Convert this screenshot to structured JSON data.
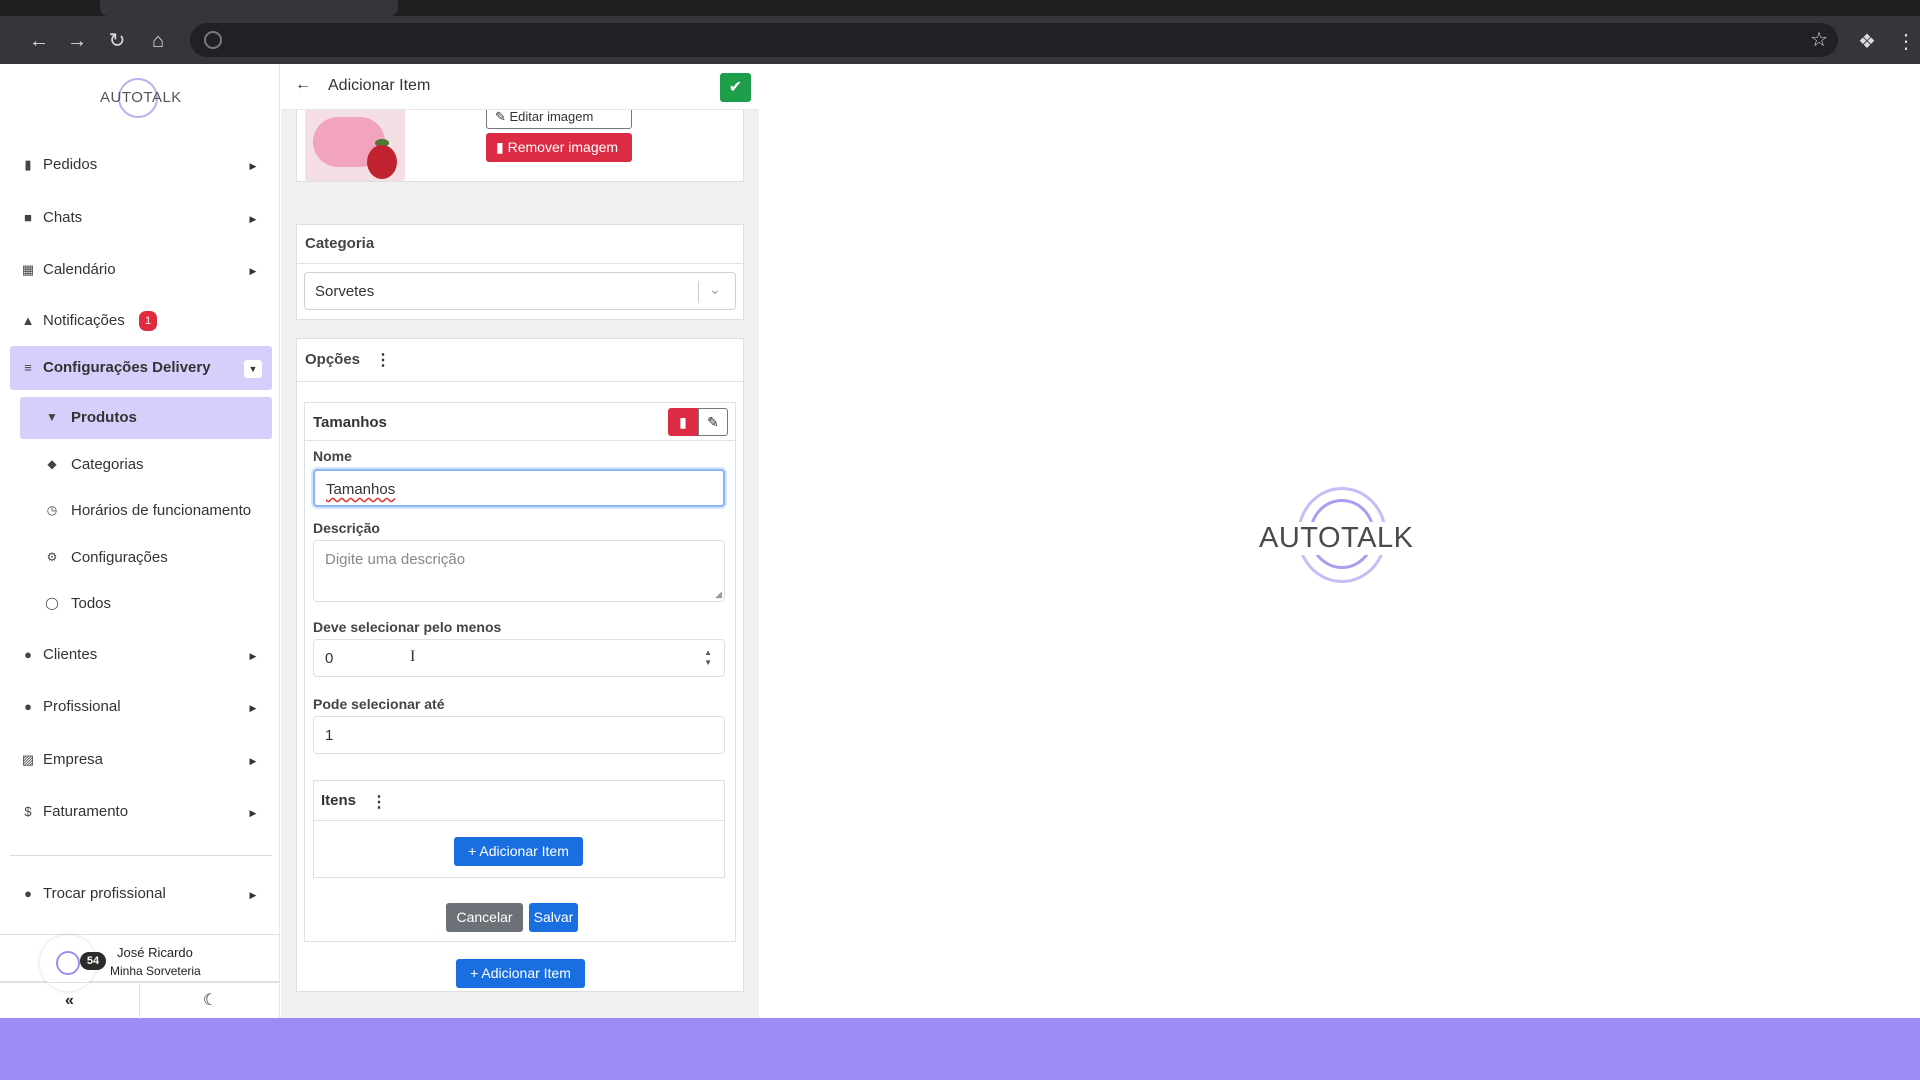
{
  "browser": {
    "back_icon": "arrow-left-icon",
    "forward_icon": "arrow-right-icon",
    "reload_icon": "reload-icon",
    "home_icon": "home-icon"
  },
  "brand": {
    "logo_text": "AUTOTALK",
    "accent_color": "#9d8cf5",
    "primary_color": "#1a6fe0",
    "danger_color": "#dc2b45",
    "success_color": "#1e9e4a"
  },
  "sidebar": {
    "items": [
      {
        "label": "Pedidos",
        "icon": "clipboard-icon"
      },
      {
        "label": "Chats",
        "icon": "chat-icon"
      },
      {
        "label": "Calendário",
        "icon": "calendar-icon"
      },
      {
        "label": "Notificações",
        "icon": "bell-icon",
        "badge": "1"
      },
      {
        "label": "Configurações Delivery",
        "icon": "sliders-icon"
      }
    ],
    "subitems": [
      {
        "label": "Produtos",
        "icon": "cone-icon"
      },
      {
        "label": "Categorias",
        "icon": "tag-icon"
      },
      {
        "label": "Horários de funcionamento",
        "icon": "clock-icon"
      },
      {
        "label": "Configurações",
        "icon": "gear-icon"
      },
      {
        "label": "Todos",
        "icon": "globe-icon"
      }
    ],
    "items2": [
      {
        "label": "Clientes",
        "icon": "users-icon"
      },
      {
        "label": "Profissional",
        "icon": "user-tie-icon"
      },
      {
        "label": "Empresa",
        "icon": "building-icon"
      },
      {
        "label": "Faturamento",
        "icon": "dollar-icon"
      }
    ],
    "switch_professional": "Trocar profissional",
    "user": {
      "name": "José Ricardo",
      "company": "Minha Sorveteria",
      "count": "54"
    },
    "footer": {
      "collapse": "«",
      "theme_icon": "moon-icon"
    }
  },
  "panel": {
    "title": "Adicionar Item",
    "image": {
      "edit_label": "Editar imagem",
      "remove_label": "Remover imagem"
    },
    "category": {
      "title": "Categoria",
      "value": "Sorvetes"
    },
    "options": {
      "title": "Opções",
      "group": {
        "title": "Tamanhos",
        "name_label": "Nome",
        "name_value": "Tamanhos",
        "description_label": "Descrição",
        "description_placeholder": "Digite uma descrição",
        "min_label": "Deve selecionar pelo menos",
        "min_value": "0",
        "max_label": "Pode selecionar até",
        "max_value": "1",
        "items_title": "Itens",
        "add_item_label": "+ Adicionar Item",
        "cancel_label": "Cancelar",
        "save_label": "Salvar"
      },
      "add_item_label": "+ Adicionar Item"
    }
  }
}
